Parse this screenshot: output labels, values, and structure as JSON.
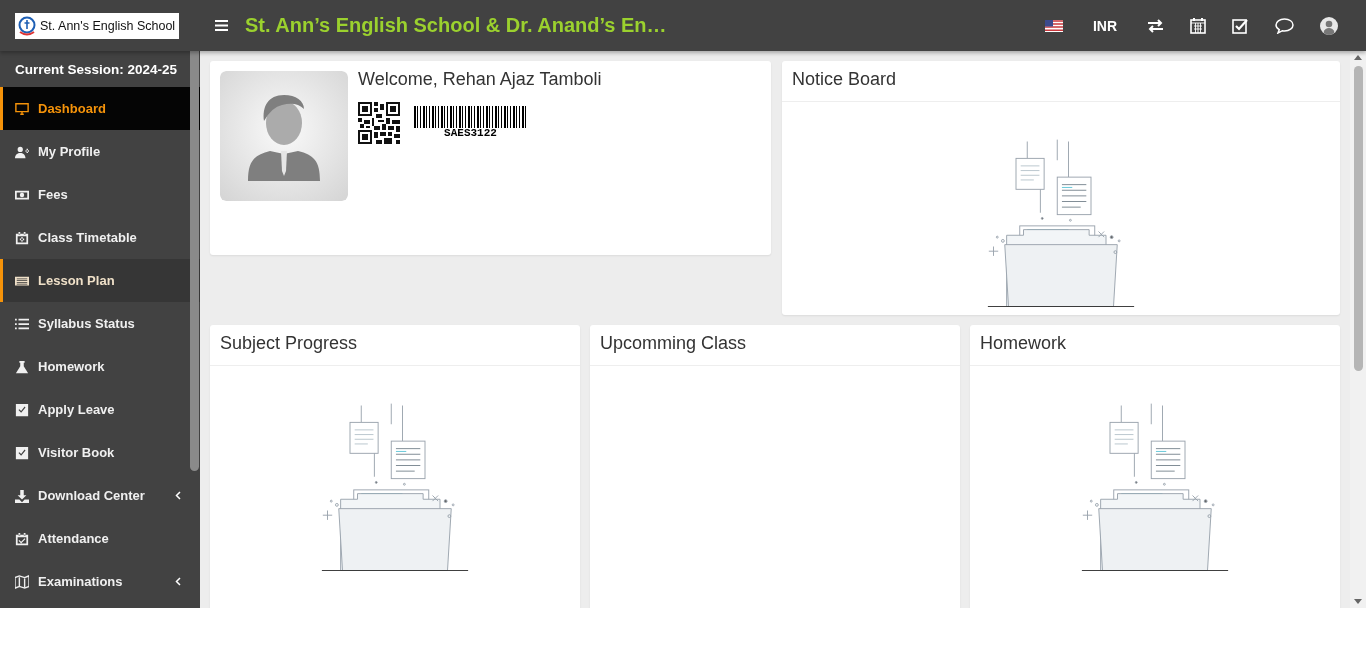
{
  "header": {
    "logo_text": "St. Ann's English School",
    "title": "St. Ann’s English School & Dr. Anand’s En…",
    "currency": "INR"
  },
  "sidebar": {
    "session": "Current Session: 2024-25",
    "items": [
      {
        "label": "Dashboard",
        "selected": true,
        "highlighted": false,
        "has_submenu": false
      },
      {
        "label": "My Profile",
        "selected": false,
        "highlighted": false,
        "has_submenu": false
      },
      {
        "label": "Fees",
        "selected": false,
        "highlighted": false,
        "has_submenu": false
      },
      {
        "label": "Class Timetable",
        "selected": false,
        "highlighted": false,
        "has_submenu": false
      },
      {
        "label": "Lesson Plan",
        "selected": false,
        "highlighted": true,
        "has_submenu": false
      },
      {
        "label": "Syllabus Status",
        "selected": false,
        "highlighted": false,
        "has_submenu": false
      },
      {
        "label": "Homework",
        "selected": false,
        "highlighted": false,
        "has_submenu": false
      },
      {
        "label": "Apply Leave",
        "selected": false,
        "highlighted": false,
        "has_submenu": false
      },
      {
        "label": "Visitor Book",
        "selected": false,
        "highlighted": false,
        "has_submenu": false
      },
      {
        "label": "Download Center",
        "selected": false,
        "highlighted": false,
        "has_submenu": true
      },
      {
        "label": "Attendance",
        "selected": false,
        "highlighted": false,
        "has_submenu": false
      },
      {
        "label": "Examinations",
        "selected": false,
        "highlighted": false,
        "has_submenu": true
      }
    ]
  },
  "welcome": {
    "greeting": "Welcome, Rehan Ajaz Tamboli",
    "barcode_text": "SAES3122"
  },
  "notice_board": {
    "title": "Notice Board",
    "empty": true
  },
  "panels": [
    {
      "title": "Subject Progress",
      "empty": true
    },
    {
      "title": "Upcomming Class",
      "empty": false
    },
    {
      "title": "Homework",
      "empty": true
    }
  ]
}
